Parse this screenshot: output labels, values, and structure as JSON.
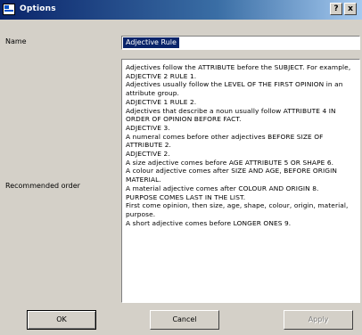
{
  "window": {
    "title": "Options",
    "help_button": "?",
    "close_button": "x"
  },
  "form": {
    "name_label": "Name",
    "name_value": "Adjective Rule",
    "recommended_label": "Recommended order",
    "recommended_text": "Adjectives follow the ATTRIBUTE before the SUBJECT. For example, ADJECTIVE 2 RULE 1.\nAdjectives usually follow the LEVEL OF THE FIRST OPINION in an attribute group.\nADJECTIVE 1 RULE 2.\nAdjectives that describe a noun usually follow ATTRIBUTE 4 IN ORDER OF OPINION BEFORE FACT.\nADJECTIVE 3.\nA numeral comes before other adjectives BEFORE SIZE OF ATTRIBUTE 2.\nADJECTIVE 2.\nA size adjective comes before AGE ATTRIBUTE 5 OR SHAPE 6.\nA colour adjective comes after SIZE AND AGE, BEFORE ORIGIN MATERIAL.\nA material adjective comes after COLOUR AND ORIGIN 8.\nPURPOSE COMES LAST IN THE LIST.\nFirst come opinion, then size, age, shape, colour, origin, material, purpose.\nA short adjective comes before LONGER ONES 9."
  },
  "buttons": {
    "ok": "OK",
    "cancel": "Cancel",
    "apply": "Apply"
  }
}
